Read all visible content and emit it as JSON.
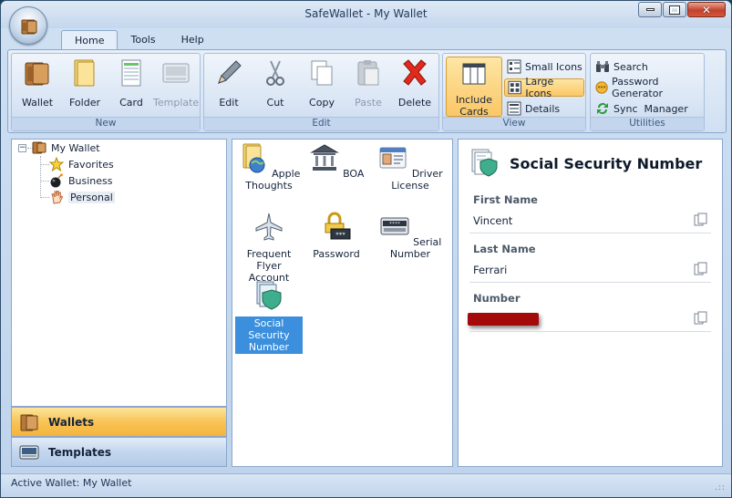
{
  "window": {
    "title": "SafeWallet - My Wallet"
  },
  "tabs": [
    {
      "label": "Home"
    },
    {
      "label": "Tools"
    },
    {
      "label": "Help"
    }
  ],
  "ribbon": {
    "new": {
      "label": "New",
      "buttons": [
        {
          "label": "Wallet",
          "icon": "wallet-icon"
        },
        {
          "label": "Folder",
          "icon": "folder-icon"
        },
        {
          "label": "Card",
          "icon": "card-icon"
        },
        {
          "label": "Template",
          "icon": "template-icon",
          "disabled": true
        }
      ]
    },
    "edit": {
      "label": "Edit",
      "buttons": [
        {
          "label": "Edit",
          "icon": "pencil-icon"
        },
        {
          "label": "Cut",
          "icon": "scissors-icon"
        },
        {
          "label": "Copy",
          "icon": "copy-icon"
        },
        {
          "label": "Paste",
          "icon": "paste-icon",
          "disabled": true
        },
        {
          "label": "Delete",
          "icon": "delete-x-icon"
        }
      ]
    },
    "view": {
      "label": "View",
      "include_cards": "Include Cards",
      "small_icons": "Small Icons",
      "large_icons": "Large Icons",
      "details": "Details"
    },
    "utilities": {
      "label": "Utilities",
      "search": "Search",
      "password_generator": "Password Generator",
      "sync_manager": "Sync  Manager"
    }
  },
  "tree": {
    "root": "My Wallet",
    "children": [
      {
        "label": "Favorites"
      },
      {
        "label": "Business"
      },
      {
        "label": "Personal"
      }
    ],
    "selected": "Personal"
  },
  "nav": {
    "wallets": "Wallets",
    "templates": "Templates"
  },
  "cards": [
    {
      "label": "Apple Thoughts",
      "icon": "folder-globe-icon"
    },
    {
      "label": "BOA",
      "icon": "bank-icon"
    },
    {
      "label": "Driver License",
      "icon": "id-card-icon"
    },
    {
      "label": "Frequent Flyer Account",
      "icon": "airplane-icon"
    },
    {
      "label": "Password",
      "icon": "lock-icon"
    },
    {
      "label": "Serial Number",
      "icon": "serial-keyboard-icon"
    },
    {
      "label": "Social Security Number",
      "icon": "shield-document-icon",
      "selected": true
    }
  ],
  "detail": {
    "title": "Social Security Number",
    "fields": [
      {
        "label": "First Name",
        "value": "Vincent"
      },
      {
        "label": "Last Name",
        "value": "Ferrari"
      },
      {
        "label": "Number",
        "value": ""
      }
    ]
  },
  "status": {
    "text": "Active Wallet: My Wallet"
  },
  "colors": {
    "accent": "#f8c457",
    "selection": "#3b8fdc",
    "frame": "#8ba7c9"
  }
}
